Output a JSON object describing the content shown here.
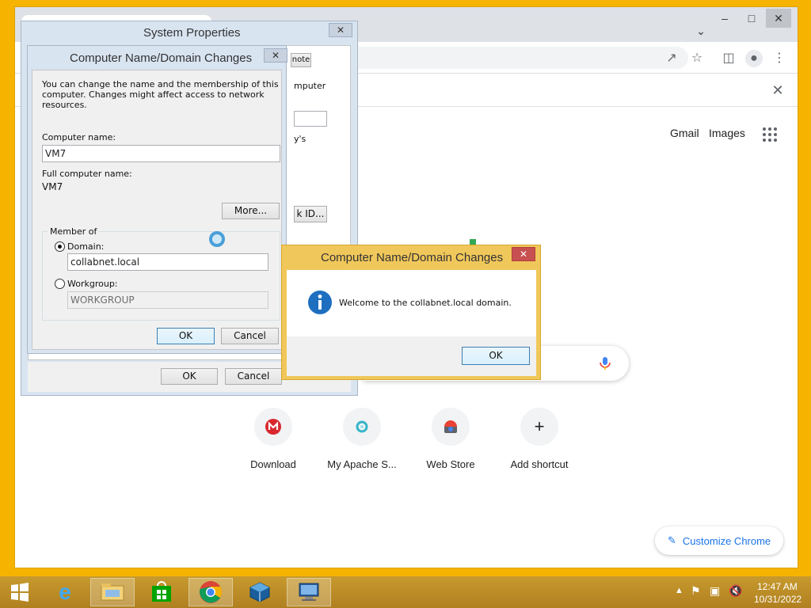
{
  "chrome": {
    "header_links": {
      "gmail": "Gmail",
      "images": "Images"
    },
    "shortcuts": [
      {
        "label": "Download",
        "icon": "mega-icon"
      },
      {
        "label": "My Apache S...",
        "icon": "apache-icon"
      },
      {
        "label": "Web Store",
        "icon": "webstore-icon"
      },
      {
        "label": "Add shortcut",
        "icon": "plus-icon",
        "glyph": "+"
      }
    ],
    "customize_label": "Customize Chrome"
  },
  "system_properties": {
    "title": "System Properties",
    "tab_fragment": "note",
    "behind_text_1": "mputer",
    "behind_text_2": "y's",
    "behind_button": "k ID...",
    "ok_label": "OK",
    "cancel_label": "Cancel"
  },
  "name_changes": {
    "title": "Computer Name/Domain Changes",
    "intro": "You can change the name and the membership of this computer. Changes might affect access to network resources.",
    "computer_name_label": "Computer name:",
    "computer_name_value": "VM7",
    "full_name_label": "Full computer name:",
    "full_name_value": "VM7",
    "more_button": "More...",
    "member_of_label": "Member of",
    "domain_label": "Domain:",
    "domain_value": "collabnet.local",
    "workgroup_label": "Workgroup:",
    "workgroup_value": "WORKGROUP",
    "ok_label": "OK",
    "cancel_label": "Cancel"
  },
  "welcome_dialog": {
    "title": "Computer Name/Domain Changes",
    "message": "Welcome to the collabnet.local domain.",
    "ok_label": "OK"
  },
  "taskbar": {
    "time": "12:47 AM",
    "date": "10/31/2022"
  },
  "colors": {
    "desktop": "#f6b400",
    "accent_blue": "#1a73e8",
    "info_icon": "#1e6fc0"
  }
}
